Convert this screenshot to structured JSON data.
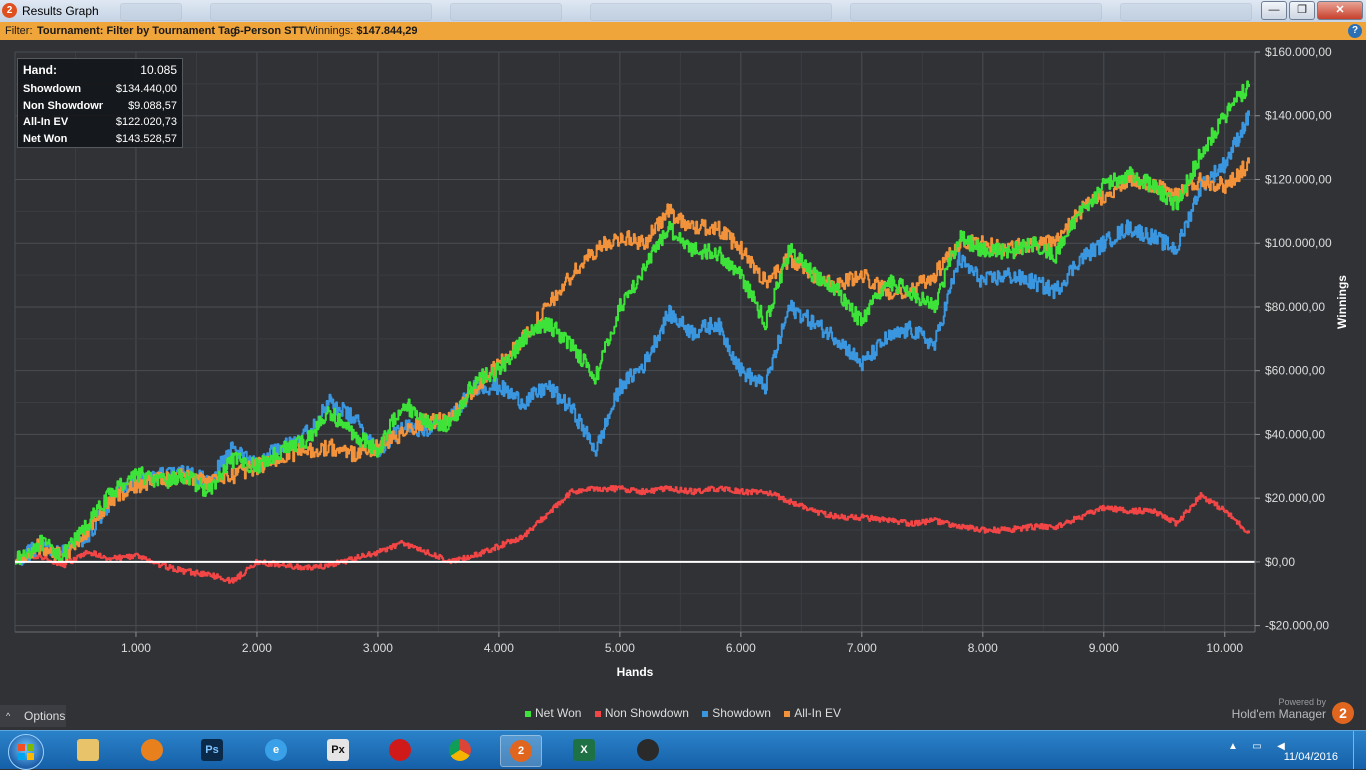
{
  "window": {
    "title": "Results Graph",
    "app_icon_glyph": "2",
    "buttons": {
      "minimize": "—",
      "maximize": "❐",
      "close": "✕"
    }
  },
  "filter": {
    "label": "Filter:",
    "tournament": "Tournament: Filter by Tournament Tag",
    "tag": "6-Person STT",
    "winnings_label": "Winnings:",
    "winnings_value": "$147.844,29",
    "help_glyph": "?"
  },
  "tooltip": {
    "hand_label": "Hand:",
    "hand_value": "10.085",
    "rows": [
      {
        "label": "Showdown",
        "value": "$134.440,00"
      },
      {
        "label": "Non Showdown",
        "value": "$9.088,57"
      },
      {
        "label": "All-In EV",
        "value": "$122.020,73"
      },
      {
        "label": "Net Won",
        "value": "$143.528,57"
      }
    ]
  },
  "chart_data": {
    "type": "line",
    "xlabel": "Hands",
    "ylabel": "Winnings",
    "xlim": [
      0,
      10250
    ],
    "ylim": [
      -22000,
      160000
    ],
    "x_ticks": [
      1000,
      2000,
      3000,
      4000,
      5000,
      6000,
      7000,
      8000,
      9000,
      10000
    ],
    "x_tick_labels": [
      "1.000",
      "2.000",
      "3.000",
      "4.000",
      "5.000",
      "6.000",
      "7.000",
      "8.000",
      "9.000",
      "10.000"
    ],
    "y_ticks": [
      -20000,
      0,
      20000,
      40000,
      60000,
      80000,
      100000,
      120000,
      140000,
      160000
    ],
    "y_tick_labels": [
      "-$20.000,00",
      "$0,00",
      "$20.000,00",
      "$40.000,00",
      "$60.000,00",
      "$80.000,00",
      "$100.000,00",
      "$120.000,00",
      "$140.000,00",
      "$160.000,00"
    ],
    "grid": true,
    "legend_position": "bottom-center",
    "x": [
      0,
      200,
      400,
      600,
      800,
      1000,
      1200,
      1400,
      1600,
      1800,
      2000,
      2200,
      2400,
      2600,
      2800,
      3000,
      3200,
      3400,
      3600,
      3800,
      4000,
      4200,
      4400,
      4600,
      4800,
      5000,
      5200,
      5400,
      5600,
      5800,
      6000,
      6200,
      6400,
      6600,
      6800,
      7000,
      7200,
      7400,
      7600,
      7800,
      8000,
      8200,
      8400,
      8600,
      8800,
      9000,
      9200,
      9400,
      9600,
      9800,
      10000,
      10200
    ],
    "series": [
      {
        "name": "Net Won",
        "color": "#3ee33a",
        "values": [
          0,
          6000,
          2000,
          12000,
          22000,
          28000,
          25000,
          27000,
          22000,
          32000,
          30000,
          35000,
          38000,
          47000,
          40000,
          35000,
          50000,
          44000,
          43000,
          57000,
          60000,
          70000,
          75000,
          68000,
          58000,
          80000,
          92000,
          105000,
          98000,
          97000,
          90000,
          75000,
          98000,
          90000,
          85000,
          75000,
          88000,
          85000,
          80000,
          102000,
          98000,
          97000,
          100000,
          96000,
          110000,
          118000,
          122000,
          118000,
          112000,
          128000,
          140000,
          150000
        ]
      },
      {
        "name": "Non Showdown",
        "color": "#f24646",
        "values": [
          0,
          2000,
          -1000,
          3000,
          1000,
          2000,
          -1000,
          -3000,
          -4000,
          -6000,
          0,
          -1000,
          -2000,
          -1000,
          1000,
          3000,
          6000,
          3000,
          0,
          2000,
          5000,
          8000,
          15000,
          22000,
          23000,
          23000,
          22000,
          23000,
          22000,
          23000,
          22000,
          22000,
          19000,
          16000,
          14000,
          14000,
          13000,
          12000,
          13000,
          11000,
          10000,
          10000,
          11000,
          11000,
          14000,
          17000,
          16000,
          16000,
          12000,
          21000,
          16000,
          9000
        ]
      },
      {
        "name": "Showdown",
        "color": "#3b96e0",
        "values": [
          0,
          5000,
          3000,
          8000,
          20000,
          26000,
          27000,
          28000,
          25000,
          36000,
          30000,
          37000,
          40000,
          50000,
          45000,
          35000,
          42000,
          42000,
          45000,
          55000,
          55000,
          50000,
          55000,
          48000,
          35000,
          55000,
          62000,
          78000,
          72000,
          75000,
          60000,
          55000,
          80000,
          75000,
          70000,
          62000,
          70000,
          73000,
          68000,
          95000,
          88000,
          90000,
          88000,
          85000,
          95000,
          100000,
          105000,
          102000,
          98000,
          118000,
          125000,
          140000
        ]
      },
      {
        "name": "All-In EV",
        "color": "#f2923a",
        "values": [
          0,
          5000,
          2000,
          10000,
          20000,
          24000,
          26000,
          27000,
          25000,
          27000,
          30000,
          33000,
          35000,
          36000,
          34000,
          36000,
          40000,
          44000,
          45000,
          55000,
          62000,
          70000,
          80000,
          90000,
          98000,
          102000,
          100000,
          110000,
          105000,
          105000,
          98000,
          88000,
          95000,
          90000,
          87000,
          90000,
          85000,
          85000,
          90000,
          100000,
          100000,
          98000,
          100000,
          100000,
          110000,
          115000,
          120000,
          118000,
          115000,
          120000,
          118000,
          125000
        ]
      }
    ]
  },
  "footer": {
    "options_label": "Options",
    "options_caret": "^",
    "powered_by": "Powered by",
    "brand": "Hold'em Manager",
    "brand_badge": "2"
  },
  "taskbar": {
    "date": "11/04/2016",
    "icons": [
      "start-orb",
      "explorer",
      "blender",
      "photoshop",
      "internet-explorer",
      "pokerx",
      "pokerstars",
      "chrome",
      "holdem-manager",
      "excel",
      "poker-client"
    ]
  }
}
